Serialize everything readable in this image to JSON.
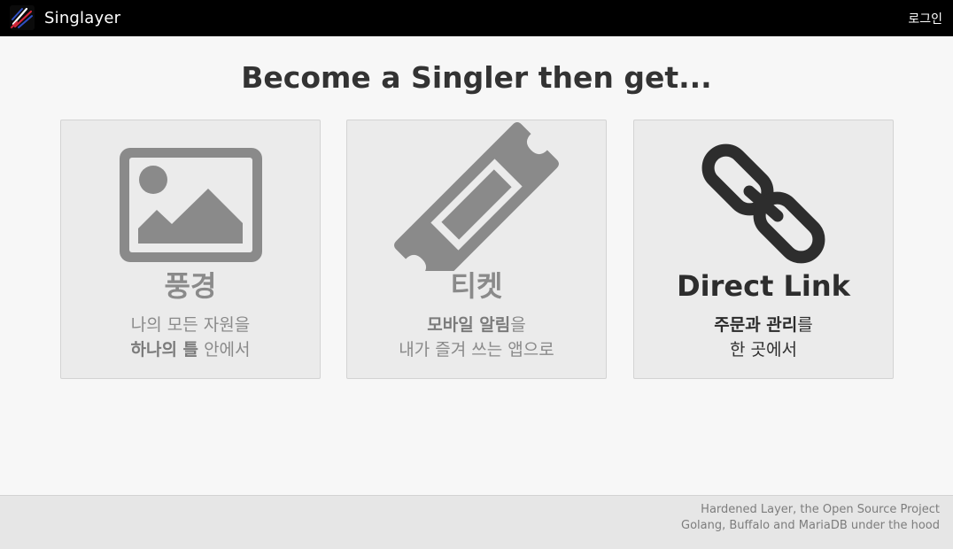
{
  "navbar": {
    "brand_name": "Singlayer",
    "login_label": "로그인",
    "background": "#000000"
  },
  "headline": "Become a Singler then get...",
  "cards": [
    {
      "icon": "image-landscape-icon",
      "title": "풍경",
      "line1_plain": "나의 모든 자원을",
      "line2_strong": "하나의 틀",
      "line2_rest": " 안에서",
      "color": "#8a8a8a"
    },
    {
      "icon": "ticket-icon",
      "title": "티켓",
      "line1_strong": "모바일 알림",
      "line1_rest": "을",
      "line2_plain": "내가 즐겨 쓰는 앱으로",
      "color": "#8a8a8a"
    },
    {
      "icon": "link-chain-icon",
      "title": "Direct Link",
      "line1_strong": "주문과 관리",
      "line1_rest": "를",
      "line2_plain": "한 곳에서",
      "color": "#2d2d2d"
    }
  ],
  "footer": {
    "line1": "Hardened Layer, the Open Source Project",
    "line2": "Golang, Buffalo and MariaDB under the hood"
  }
}
